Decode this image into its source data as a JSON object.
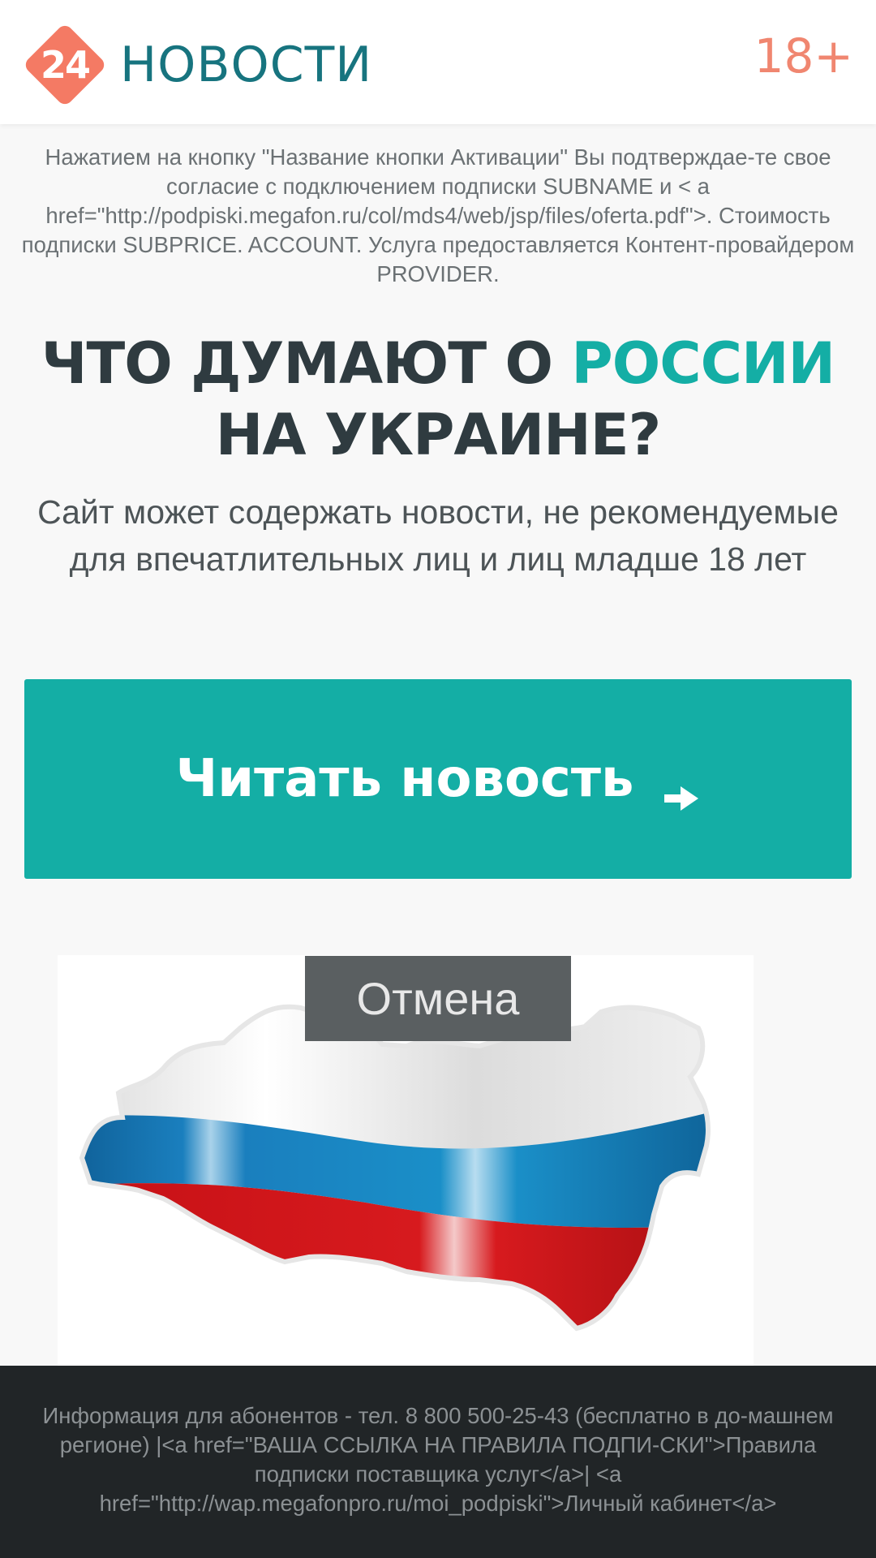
{
  "header": {
    "logo_number": "24",
    "logo_text": "НОВОСТИ",
    "age_badge": "18+"
  },
  "disclaimer": "Нажатием на кнопку \"Название кнопки Активации\" Вы подтверждае-те свое согласие с подключением подписки SUBNAME и < a href=\"http://podpiski.megafon.ru/col/mds4/web/jsp/files/oferta.pdf\">. Стоимость подписки SUBPRICE. ACCOUNT. Услуга предоставляется Контент-провайдером PROVIDER.",
  "headline": {
    "part1": "ЧТО ДУМАЮТ О ",
    "accent": "РОССИИ",
    "line2": "НА УКРАИНЕ?"
  },
  "subtitle": "Сайт может содержать новости, не рекомендуемые для впечатлительных лиц и лиц младше 18 лет",
  "cta": {
    "label": "Читать новость",
    "icon": "arrow-right-icon"
  },
  "cancel_label": "Отмена",
  "image": {
    "icon": "russia-flag-map-image"
  },
  "footer": {
    "text": "Информация для абонентов - тел. 8 800 500-25-43 (бесплатно в до-машнем регионе) |<a href=\"ВАША ССЫЛКА НА ПРАВИЛА ПОДПИ-СКИ\">Правила подписки поставщика услуг</a>| <a href=\"http://wap.megafonpro.ru/moi_podpiski\">Личный кабинет</a>"
  },
  "colors": {
    "accent": "#14aea5",
    "logo_coral": "#f47a64",
    "logo_text": "#17747f",
    "age": "#f08670",
    "footer_bg": "#212527"
  }
}
